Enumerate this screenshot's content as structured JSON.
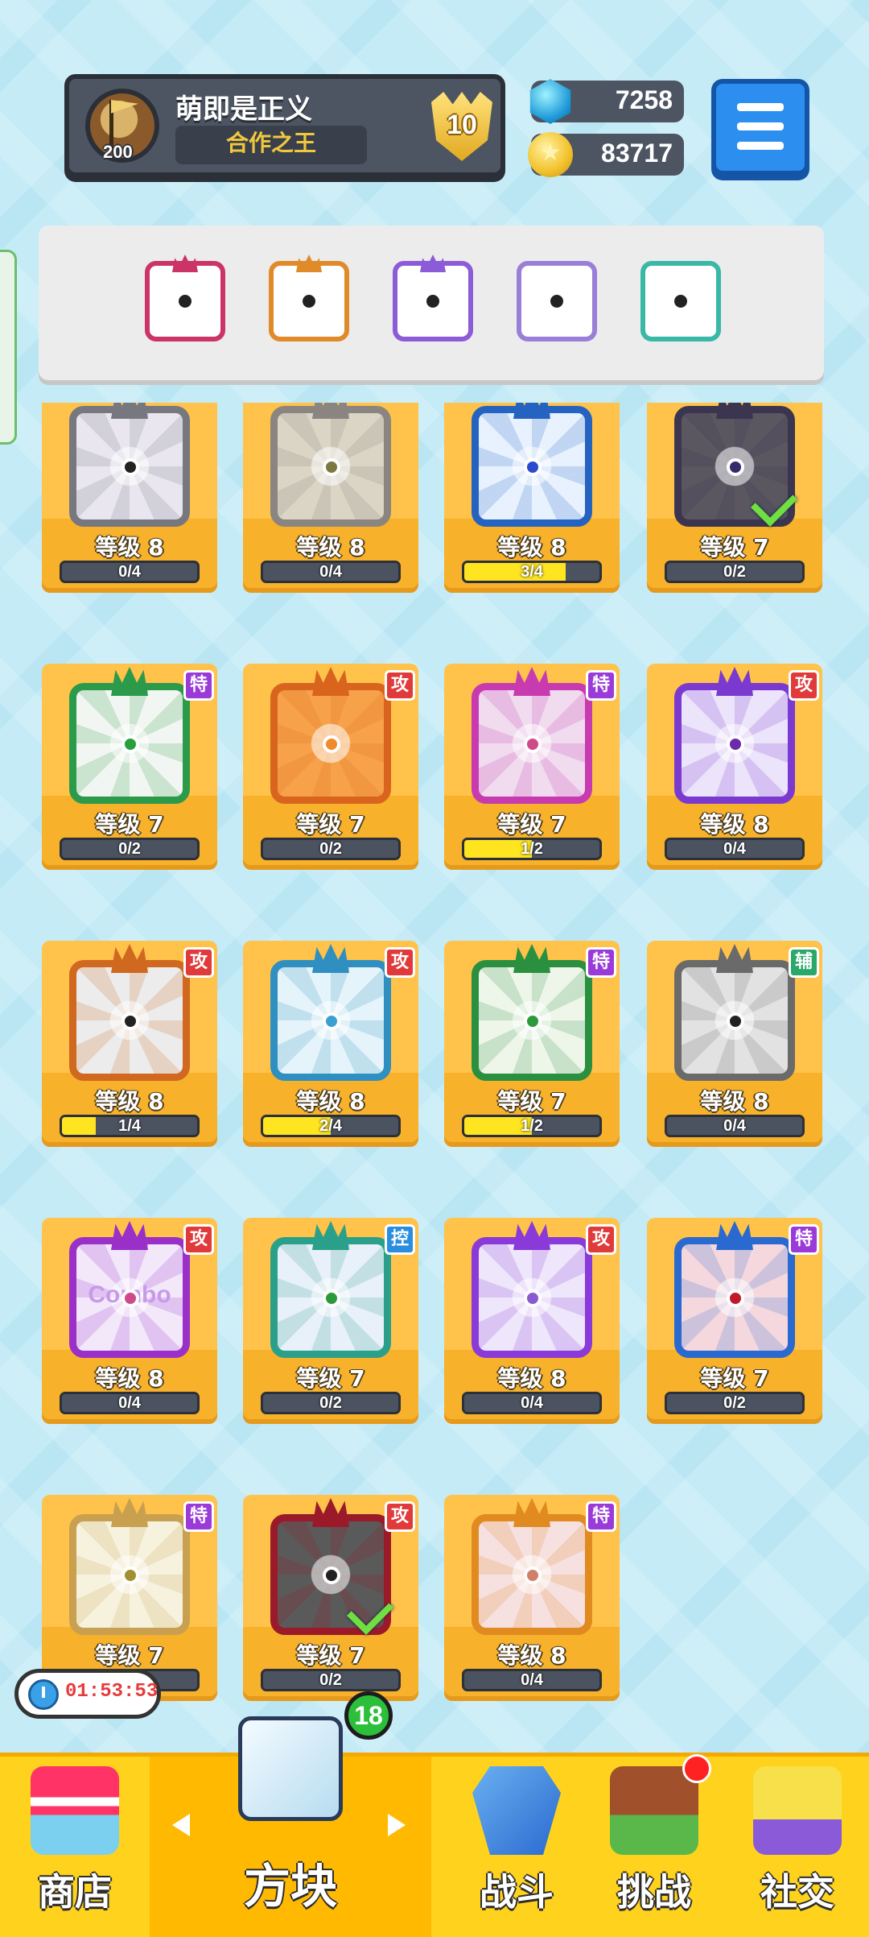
{
  "player": {
    "name": "萌即是正义",
    "title": "合作之王",
    "avatar_level": "200",
    "rank": "10"
  },
  "currency": {
    "gems": "7258",
    "coins": "83717"
  },
  "icons": {
    "menu": "menu-icon",
    "gem": "gem-icon",
    "coin": "coin-icon",
    "clock": "clock-icon"
  },
  "deck": [
    {
      "name": "saw",
      "color": "#cc3366"
    },
    {
      "name": "infinity",
      "color": "#e08a2a"
    },
    {
      "name": "purple",
      "color": "#8c5bd8"
    },
    {
      "name": "mystery",
      "color": "#9a7fd8"
    },
    {
      "name": "hands",
      "color": "#39b8a8"
    }
  ],
  "cards": [
    {
      "level": "等级 8",
      "progress": "0/4",
      "fill": 0,
      "frame": "#77777f",
      "bg": "#e9e6f0",
      "dot": "#222222",
      "tag": ""
    },
    {
      "level": "等级 8",
      "progress": "0/4",
      "fill": 0,
      "frame": "#8a8580",
      "bg": "#dad5c4",
      "dot": "#7a7a40",
      "tag": ""
    },
    {
      "level": "等级 8",
      "progress": "3/4",
      "fill": 0.75,
      "frame": "#2463c0",
      "bg": "#e8f2ff",
      "dot": "#2a4ad0",
      "tag": ""
    },
    {
      "level": "等级 7",
      "progress": "0/2",
      "fill": 0,
      "frame": "#3b3550",
      "bg": "#5a5760",
      "dot": "#352b6a",
      "tag": "",
      "check": true
    },
    {
      "level": "等级 7",
      "progress": "0/2",
      "fill": 0,
      "frame": "#2b9a4a",
      "bg": "#f2f6f2",
      "dot": "#27a03a",
      "tag": "特",
      "tagColor": "#9a3ad8"
    },
    {
      "level": "等级 7",
      "progress": "0/2",
      "fill": 0,
      "frame": "#d9641e",
      "bg": "#f7a24a",
      "dot": "#f08a2a",
      "tag": "攻",
      "tagColor": "#e03a3a"
    },
    {
      "level": "等级 7",
      "progress": "1/2",
      "fill": 0.5,
      "frame": "#c83ab0",
      "bg": "#f0dcee",
      "dot": "#d04a8a",
      "tag": "特",
      "tagColor": "#9a3ad8"
    },
    {
      "level": "等级 8",
      "progress": "0/4",
      "fill": 0,
      "frame": "#7a3ad0",
      "bg": "#ece4fa",
      "dot": "#6a2aaa",
      "tag": "攻",
      "tagColor": "#e03a3a"
    },
    {
      "level": "等级 8",
      "progress": "1/4",
      "fill": 0.25,
      "frame": "#d06820",
      "bg": "#ececec",
      "dot": "#222222",
      "tag": "攻",
      "tagColor": "#e03a3a"
    },
    {
      "level": "等级 8",
      "progress": "2/4",
      "fill": 0.5,
      "frame": "#2f8fc0",
      "bg": "#e4f4fa",
      "dot": "#3aa0d0",
      "tag": "攻",
      "tagColor": "#e03a3a"
    },
    {
      "level": "等级 7",
      "progress": "1/2",
      "fill": 0.5,
      "frame": "#2a9040",
      "bg": "#eef6ea",
      "dot": "#2a9a3a",
      "tag": "特",
      "tagColor": "#9a3ad8"
    },
    {
      "level": "等级 8",
      "progress": "0/4",
      "fill": 0,
      "frame": "#6a6a6a",
      "bg": "#e2e2e2",
      "dot": "#222222",
      "tag": "辅",
      "tagColor": "#2aa86a"
    },
    {
      "level": "等级 8",
      "progress": "0/4",
      "fill": 0,
      "frame": "#9a30c8",
      "bg": "#f2e8fa",
      "dot": "#d04a8a",
      "tag": "攻",
      "tagColor": "#e03a3a",
      "text": "Combo"
    },
    {
      "level": "等级 7",
      "progress": "0/2",
      "fill": 0,
      "frame": "#2aa08a",
      "bg": "#e8f0fa",
      "dot": "#2a9a3a",
      "tag": "控",
      "tagColor": "#2a8ee0"
    },
    {
      "level": "等级 8",
      "progress": "0/4",
      "fill": 0,
      "frame": "#8a3ad8",
      "bg": "#eee6fa",
      "dot": "#8a5ad0",
      "tag": "攻",
      "tagColor": "#e03a3a"
    },
    {
      "level": "等级 7",
      "progress": "0/2",
      "fill": 0,
      "frame": "#2a6ad0",
      "bg": "#f4d8de",
      "dot": "#c01a2a",
      "tag": "特",
      "tagColor": "#9a3ad8"
    },
    {
      "level": "等级 7",
      "progress": "0/2",
      "fill": 0,
      "frame": "#c8a050",
      "bg": "#f6f2de",
      "dot": "#a09030",
      "tag": "特",
      "tagColor": "#9a3ad8"
    },
    {
      "level": "等级 7",
      "progress": "0/2",
      "fill": 0,
      "frame": "#9a1a2a",
      "bg": "#5a5a5a",
      "dot": "#222222",
      "tag": "攻",
      "tagColor": "#e03a3a",
      "check": true
    },
    {
      "level": "等级 8",
      "progress": "0/4",
      "fill": 0,
      "frame": "#e08a20",
      "bg": "#f6e0e0",
      "dot": "#d0806a",
      "tag": "特",
      "tagColor": "#9a3ad8"
    }
  ],
  "timer": "01:53:53",
  "dice_box_count": "18",
  "nav": [
    {
      "label": "商店",
      "icon": "shop-icon"
    },
    {
      "label": "方块",
      "icon": "dice-box-icon",
      "active": true
    },
    {
      "label": "战斗",
      "icon": "battle-icon"
    },
    {
      "label": "挑战",
      "icon": "challenge-icon"
    },
    {
      "label": "社交",
      "icon": "social-icon"
    }
  ]
}
